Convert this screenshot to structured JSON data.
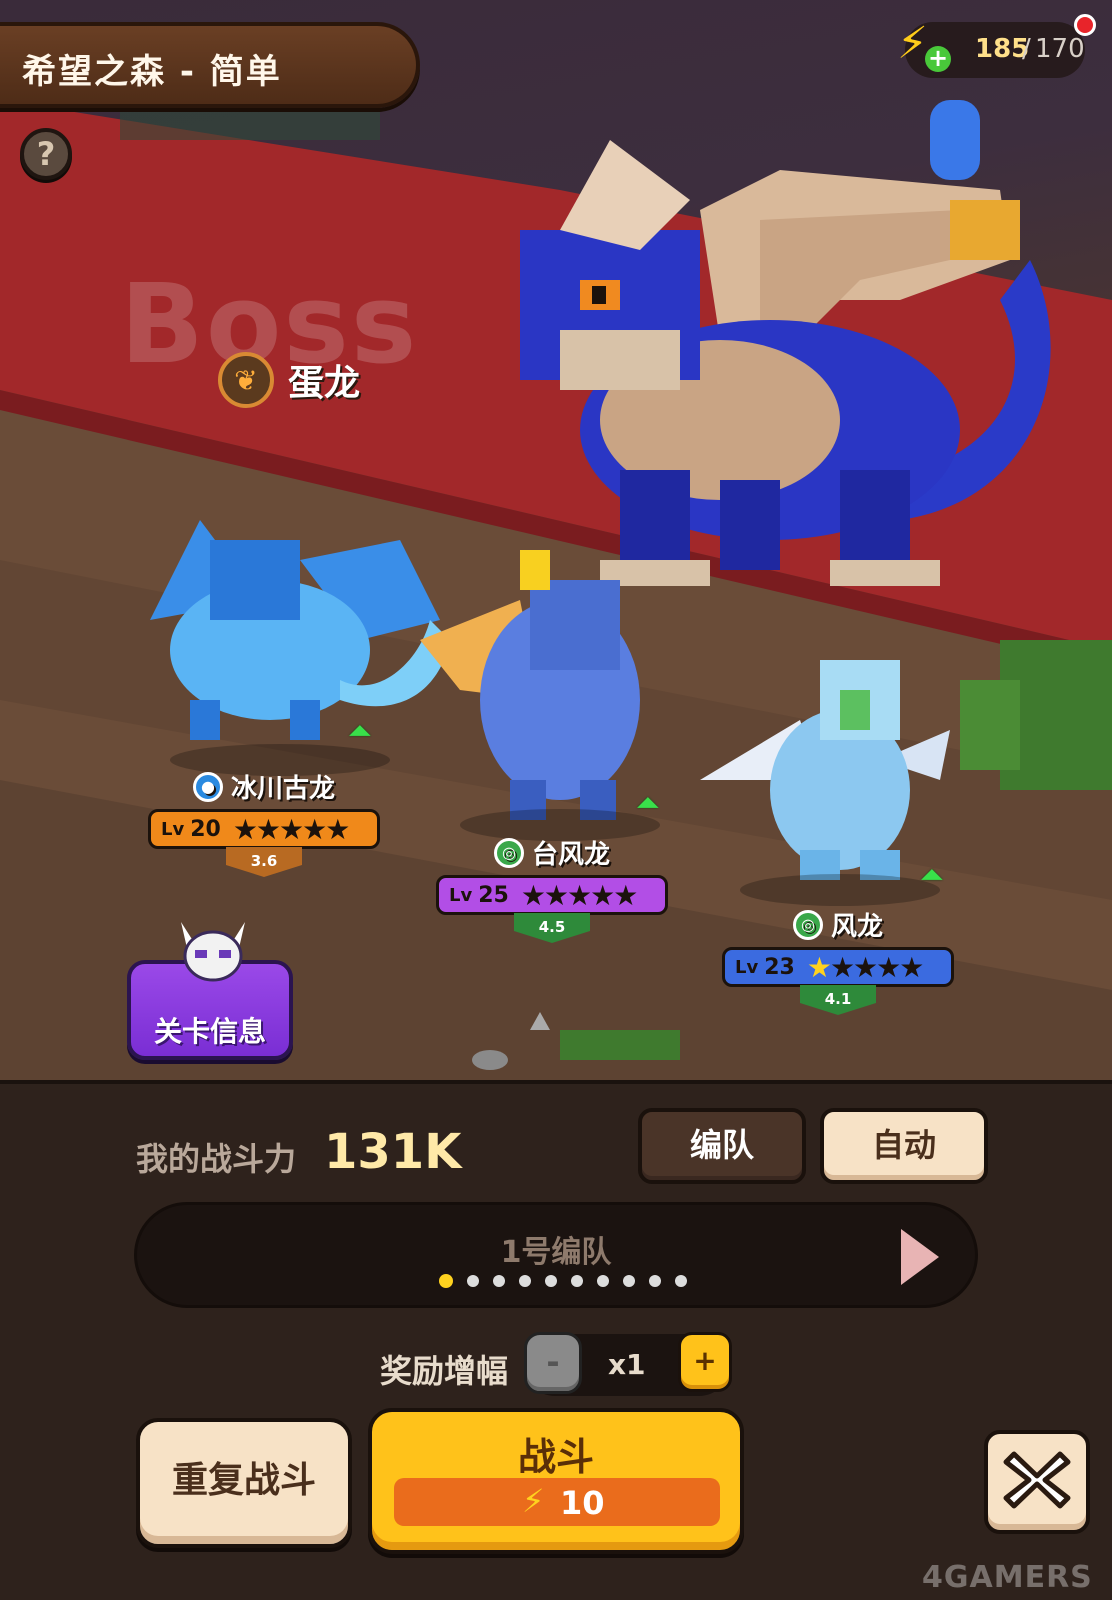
{
  "stage": {
    "title": "希望之森 - 简单"
  },
  "help": {
    "glyph": "?"
  },
  "energy": {
    "current": "185",
    "separator": "/",
    "max": "170",
    "bolt": "⚡",
    "plus": "+"
  },
  "boss": {
    "watermark": "Boss",
    "name": "蛋龙",
    "element_icon": "sprout-icon"
  },
  "heroes": [
    {
      "name": "冰川古龙",
      "element": "water",
      "lv_label": "Lv",
      "level": "20",
      "stars": 5,
      "gold_stars": 0,
      "power": "3.6",
      "bar_color": "#f0891a",
      "tag_color": "#b86a22"
    },
    {
      "name": "台风龙",
      "element": "wind",
      "lv_label": "Lv",
      "level": "25",
      "stars": 5,
      "gold_stars": 0,
      "power": "4.5",
      "bar_color": "#b24ee6",
      "tag_color": "#2e8a3a"
    },
    {
      "name": "风龙",
      "element": "wind",
      "lv_label": "Lv",
      "level": "23",
      "stars": 5,
      "gold_stars": 1,
      "power": "4.1",
      "bar_color": "#3b6be0",
      "tag_color": "#2e8a3a"
    }
  ],
  "stage_info": {
    "label": "关卡信息"
  },
  "panel": {
    "power_label": "我的战斗力",
    "power_value": "131K",
    "formation_button": "编队",
    "auto_button": "自动",
    "team_name": "1号编队",
    "team_dots": 10,
    "team_active_index": 0,
    "bonus_label": "奖励增幅",
    "bonus_minus": "-",
    "bonus_multiplier": "x1",
    "bonus_plus": "+",
    "repeat_button": "重复战斗",
    "fight_button": "战斗",
    "fight_cost": "10",
    "fight_cost_icon": "⚡"
  },
  "watermark": "4GAMERS",
  "colors": {
    "accent_yellow": "#ffc21a",
    "panel_bg": "#2e221c",
    "cream": "#f7e2c6"
  }
}
